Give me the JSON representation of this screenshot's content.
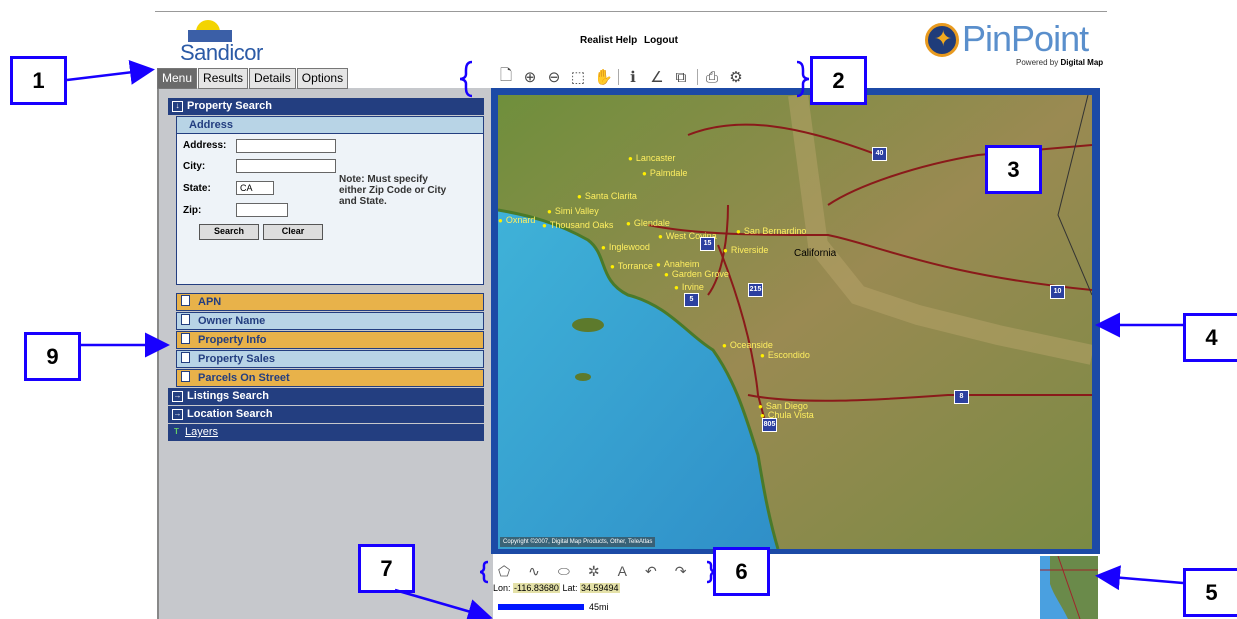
{
  "header": {
    "sandicor_logo": "Sandicor",
    "links": [
      "Realist Help",
      "Logout"
    ],
    "pinpoint_logo": "PinPoint",
    "powered_by": "Powered by",
    "powered_by_brand": "Digital Map"
  },
  "tabs": [
    "Menu",
    "Results",
    "Details",
    "Options"
  ],
  "toolbar_icons": [
    "new-page-icon",
    "zoom-in-icon",
    "zoom-out-icon",
    "zoom-extent-icon",
    "pan-icon",
    "identify-icon",
    "measure-icon",
    "layers-icon",
    "print-icon",
    "settings-icon"
  ],
  "menu": {
    "property_search": "Property Search",
    "address_header": "Address",
    "address_label": "Address:",
    "city_label": "City:",
    "state_label": "State:",
    "state_value": "CA",
    "zip_label": "Zip:",
    "note": "Note: Must specify either Zip Code or City and State.",
    "search_btn": "Search",
    "clear_btn": "Clear",
    "apn": "APN",
    "owner_name": "Owner Name",
    "property_info": "Property Info",
    "property_sales": "Property Sales",
    "parcels_on_street": "Parcels On Street",
    "listings_search": "Listings Search",
    "location_search": "Location Search",
    "layers": "Layers"
  },
  "map": {
    "copyright": "Copyright ©2007, Digital Map Products, Other, TeleAtlas",
    "region_label": "California",
    "cities": [
      "Lancaster",
      "Palmdale",
      "Santa Clarita",
      "Simi Valley",
      "Oxnard",
      "Thousand Oaks",
      "Glendale",
      "West Covina",
      "San Bernardino",
      "Inglewood",
      "Riverside",
      "Torrance",
      "Anaheim",
      "Garden Grove",
      "Irvine",
      "Oceanside",
      "Escondido",
      "San Diego",
      "Chula Vista"
    ],
    "highways": [
      "40",
      "15",
      "215",
      "5",
      "10",
      "8",
      "805"
    ]
  },
  "coords": {
    "lon_label": "Lon:",
    "lon": "-116.83680",
    "lat_label": "Lat:",
    "lat": "34.59494"
  },
  "scale": "45mi",
  "callouts": [
    "1",
    "2",
    "3",
    "4",
    "5",
    "6",
    "7",
    "9"
  ],
  "colors": {
    "callout_border": "#1800ff",
    "panel_header": "#233e80",
    "row_orange": "#e8b24a",
    "row_blue": "#b8d4e6"
  }
}
